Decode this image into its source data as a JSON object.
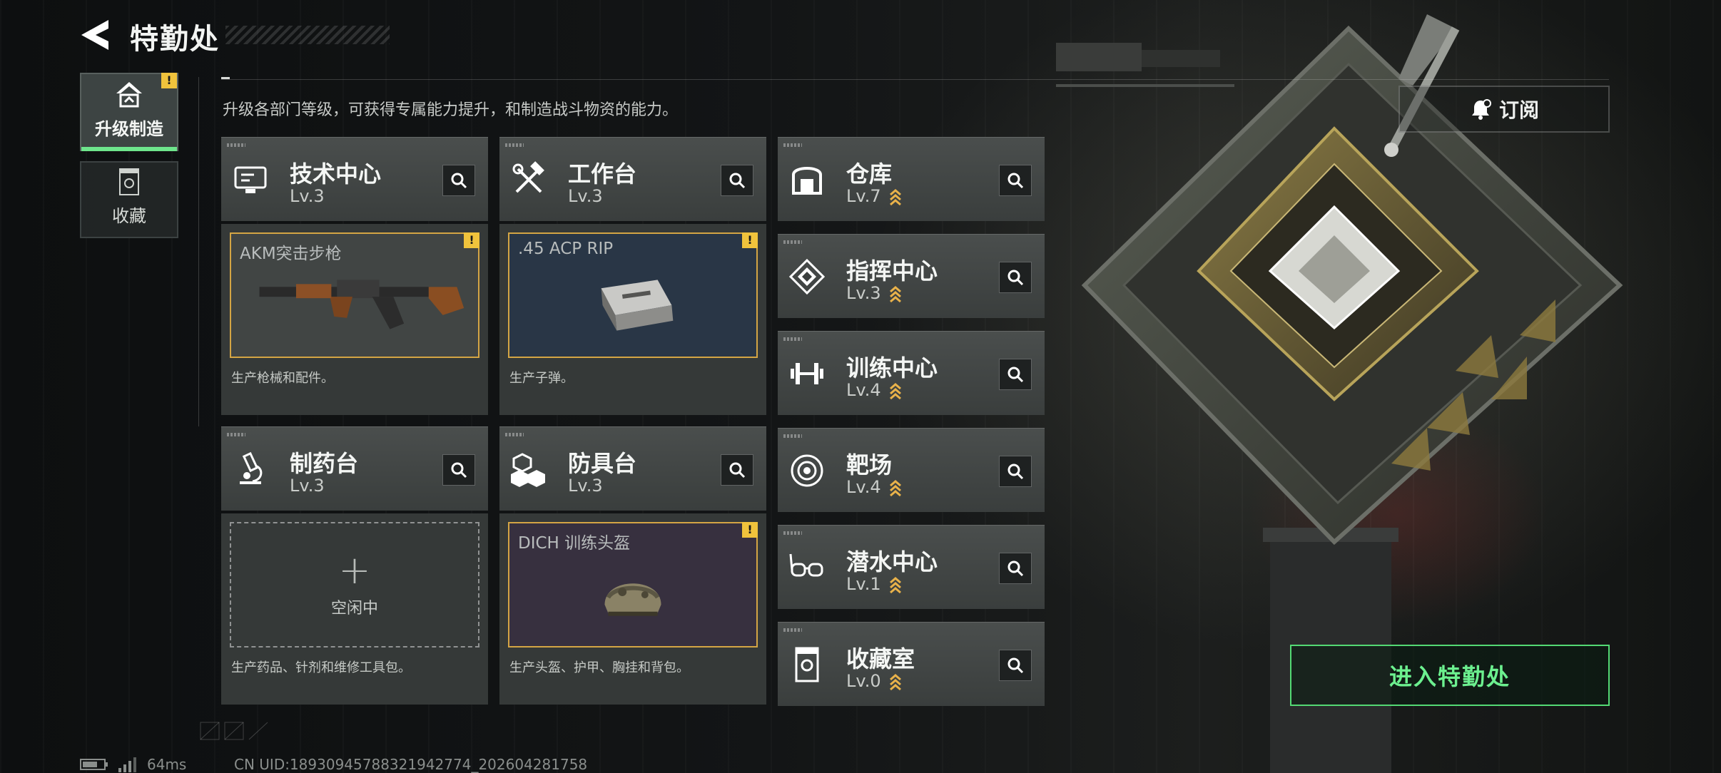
{
  "header": {
    "title": "特勤处",
    "subtitle": "升级各部门等级，可获得专属能力提升，和制造战斗物资的能力。"
  },
  "nav": {
    "tabs": [
      {
        "label": "升级制造",
        "active": true,
        "badge": "!"
      },
      {
        "label": "收藏",
        "active": false
      }
    ]
  },
  "subscribe": {
    "label": "订阅"
  },
  "departments": {
    "tech_center": {
      "name": "技术中心",
      "level": "Lv.3",
      "icon": "monitor-icon"
    },
    "workbench": {
      "name": "工作台",
      "level": "Lv.3",
      "icon": "hammer-wrench-icon"
    },
    "pharmacy": {
      "name": "制药台",
      "level": "Lv.3",
      "icon": "microscope-icon"
    },
    "armor_bench": {
      "name": "防具台",
      "level": "Lv.3",
      "icon": "cubes-icon"
    },
    "warehouse": {
      "name": "仓库",
      "level": "Lv.7",
      "icon": "vault-icon",
      "upgradable": true
    },
    "command": {
      "name": "指挥中心",
      "level": "Lv.3",
      "icon": "chip-icon",
      "upgradable": true
    },
    "training": {
      "name": "训练中心",
      "level": "Lv.4",
      "icon": "dumbbell-icon",
      "upgradable": true
    },
    "range": {
      "name": "靶场",
      "level": "Lv.4",
      "icon": "target-icon",
      "upgradable": true
    },
    "diving": {
      "name": "潜水中心",
      "level": "Lv.1",
      "icon": "diving-mask-icon",
      "upgradable": true
    },
    "collection": {
      "name": "收藏室",
      "level": "Lv.0",
      "icon": "trophy-icon",
      "upgradable": true
    }
  },
  "production": {
    "tech_center": {
      "item": "AKM突击步枪",
      "desc": "生产枪械和配件。",
      "badge": "!",
      "state": "producing"
    },
    "workbench": {
      "item": ".45 ACP RIP",
      "desc": "生产子弹。",
      "badge": "!",
      "state": "producing"
    },
    "pharmacy": {
      "idle_label": "空闲中",
      "plus": "+",
      "desc": "生产药品、针剂和维修工具包。",
      "state": "idle"
    },
    "armor_bench": {
      "item": "DICH 训练头盔",
      "desc": "生产头盔、护甲、胸挂和背包。",
      "badge": "!",
      "state": "producing"
    }
  },
  "enter_button": {
    "label": "进入特勤处"
  },
  "footer": {
    "ping": "64ms",
    "uid": "CN UID:18930945788321942774_202604281758"
  },
  "colors": {
    "accent_green": "#6cf08f",
    "warning_yellow": "#f0c33c",
    "frame_gold": "#d4a544",
    "upgrade_chevron": "#e9b24a"
  }
}
